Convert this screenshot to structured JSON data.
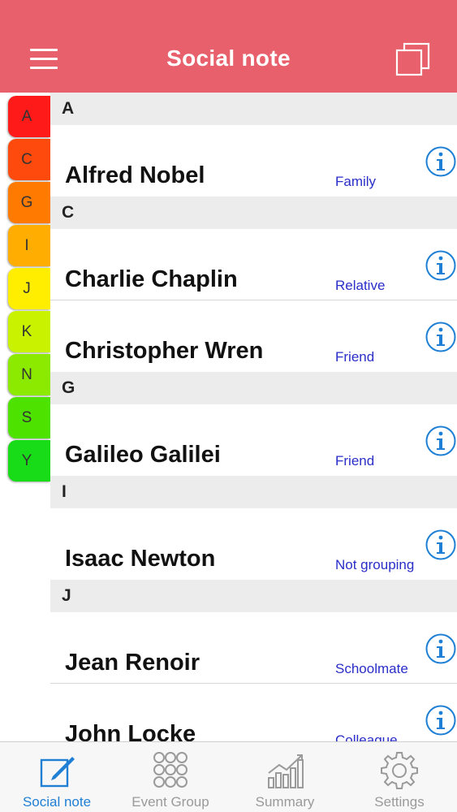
{
  "header": {
    "title": "Social note",
    "menu_icon": "hamburger-menu-icon",
    "right_icon": "duplicate-pages-icon"
  },
  "colors": {
    "header_bg": "#e8606b",
    "link_blue": "#2a2ec7",
    "info_blue": "#1f7fd4"
  },
  "index": [
    {
      "letter": "A",
      "color": "#ff1a1a"
    },
    {
      "letter": "C",
      "color": "#ff4a0d"
    },
    {
      "letter": "G",
      "color": "#ff7a00"
    },
    {
      "letter": "I",
      "color": "#ffad00"
    },
    {
      "letter": "J",
      "color": "#ffee00"
    },
    {
      "letter": "K",
      "color": "#c8f200"
    },
    {
      "letter": "N",
      "color": "#8bea00"
    },
    {
      "letter": "S",
      "color": "#4ee200"
    },
    {
      "letter": "Y",
      "color": "#18dc18"
    }
  ],
  "sections": [
    {
      "letter": "A",
      "contacts": [
        {
          "name": "Alfred Nobel",
          "group": "Family"
        }
      ]
    },
    {
      "letter": "C",
      "contacts": [
        {
          "name": "Charlie Chaplin",
          "group": "Relative"
        },
        {
          "name": "Christopher Wren",
          "group": "Friend"
        }
      ]
    },
    {
      "letter": "G",
      "contacts": [
        {
          "name": "Galileo Galilei",
          "group": "Friend"
        }
      ]
    },
    {
      "letter": "I",
      "contacts": [
        {
          "name": "Isaac Newton",
          "group": "Not grouping"
        }
      ]
    },
    {
      "letter": "J",
      "contacts": [
        {
          "name": "Jean Renoir",
          "group": "Schoolmate"
        },
        {
          "name": "John Locke",
          "group": "Colleague"
        }
      ]
    }
  ],
  "tabs": [
    {
      "label": "Social note",
      "icon": "compose-note-icon",
      "active": true
    },
    {
      "label": "Event Group",
      "icon": "grid-dots-icon",
      "active": false
    },
    {
      "label": "Summary",
      "icon": "bar-chart-icon",
      "active": false
    },
    {
      "label": "Settings",
      "icon": "gear-icon",
      "active": false
    }
  ]
}
